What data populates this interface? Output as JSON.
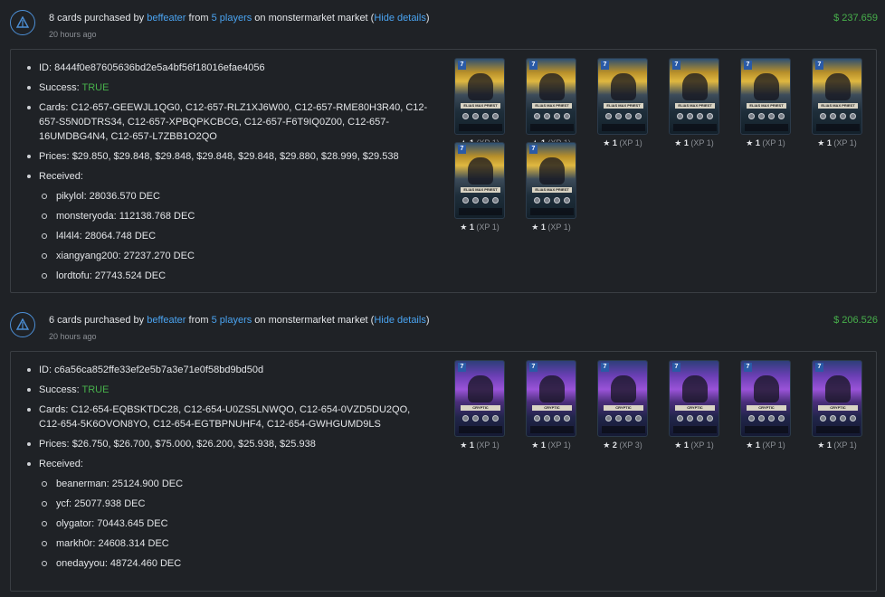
{
  "transactions": [
    {
      "summary": {
        "count_text": "8 cards purchased by",
        "buyer": "beffeater",
        "from_text": "from",
        "players": "5 players",
        "market_text": "on monstermarket market (",
        "hide_details": "Hide details",
        "close_paren": ")"
      },
      "time": "20 hours ago",
      "amount": "$ 237.659",
      "id_label": "ID:",
      "id": "8444f0e87605636bd2e5a4bf56f18016efae4056",
      "success_label": "Success:",
      "success": "TRUE",
      "cards_label": "Cards:",
      "cards": "C12-657-GEEWJL1QG0, C12-657-RLZ1XJ6W00, C12-657-RME80H3R40, C12-657-S5N0DTRS34, C12-657-XPBQPKCBCG, C12-657-F6T9IQ0Z00, C12-657-16UMDBG4N4, C12-657-L7ZBB1O2QO",
      "prices_label": "Prices:",
      "prices": "$29.850, $29.848, $29.848, $29.848, $29.848, $29.880, $28.999, $29.538",
      "received_label": "Received:",
      "received": [
        "pikylol: 28036.570 DEC",
        "monsteryoda: 112138.768 DEC",
        "l4l4l4: 28064.748 DEC",
        "xiangyang200: 27237.270 DEC",
        "lordtofu: 27743.524 DEC"
      ],
      "card_name": "ELIAS MAX PRIEST",
      "card_level": "7",
      "card_items": [
        {
          "level": "1",
          "xp": "(XP 1)"
        },
        {
          "level": "1",
          "xp": "(XP 1)"
        },
        {
          "level": "1",
          "xp": "(XP 1)"
        },
        {
          "level": "1",
          "xp": "(XP 1)"
        },
        {
          "level": "1",
          "xp": "(XP 1)"
        },
        {
          "level": "1",
          "xp": "(XP 1)"
        },
        {
          "level": "1",
          "xp": "(XP 1)"
        },
        {
          "level": "1",
          "xp": "(XP 1)"
        }
      ]
    },
    {
      "summary": {
        "count_text": "6 cards purchased by",
        "buyer": "beffeater",
        "from_text": "from",
        "players": "5 players",
        "market_text": "on monstermarket market (",
        "hide_details": "Hide details",
        "close_paren": ")"
      },
      "time": "20 hours ago",
      "amount": "$ 206.526",
      "id_label": "ID:",
      "id": "c6a56ca852ffe33ef2e5b7a3e71e0f58bd9bd50d",
      "success_label": "Success:",
      "success": "TRUE",
      "cards_label": "Cards:",
      "cards": "C12-654-EQBSKTDC28, C12-654-U0ZS5LNWQO, C12-654-0VZD5DU2QO, C12-654-5K6OVON8YO, C12-654-EGTBPNUHF4, C12-654-GWHGUMD9LS",
      "prices_label": "Prices:",
      "prices": "$26.750, $26.700, $75.000, $26.200, $25.938, $25.938",
      "received_label": "Received:",
      "received": [
        "beanerman: 25124.900 DEC",
        "ycf: 25077.938 DEC",
        "olygator: 70443.645 DEC",
        "markh0r: 24608.314 DEC",
        "onedayyou: 48724.460 DEC"
      ],
      "card_name": "CRYPTIC",
      "card_level": "7",
      "card_items": [
        {
          "level": "1",
          "xp": "(XP 1)"
        },
        {
          "level": "1",
          "xp": "(XP 1)"
        },
        {
          "level": "2",
          "xp": "(XP 3)"
        },
        {
          "level": "1",
          "xp": "(XP 1)"
        },
        {
          "level": "1",
          "xp": "(XP 1)"
        },
        {
          "level": "1",
          "xp": "(XP 1)"
        }
      ]
    }
  ],
  "icons": {
    "market": "market-logo-icon",
    "star": "star-icon"
  },
  "colors": {
    "link": "#4aa3f0",
    "amount": "#47b04b",
    "success": "#47b04b",
    "background": "#1f2226",
    "border": "#3a3e43"
  }
}
